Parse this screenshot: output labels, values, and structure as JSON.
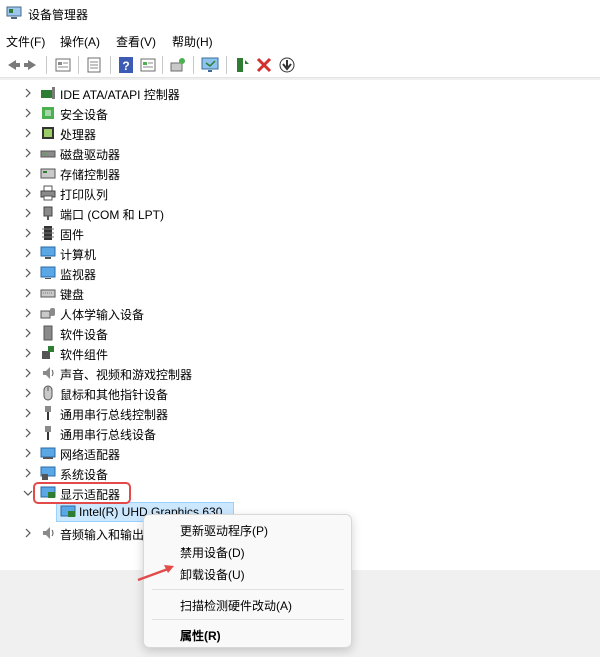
{
  "window": {
    "title": "设备管理器"
  },
  "menu": [
    "文件(F)",
    "操作(A)",
    "查看(V)",
    "帮助(H)"
  ],
  "toolbar": {
    "buttons": [
      "back-arrow-icon",
      "forward-arrow-icon",
      "properties-sheet-icon",
      "document-icon",
      "help-icon",
      "view-icon",
      "scan-hardware-icon",
      "monitor-icon",
      "update-driver-icon",
      "uninstall-x-icon",
      "download-icon"
    ]
  },
  "tree": {
    "categories": [
      "IDE ATA/ATAPI 控制器",
      "安全设备",
      "处理器",
      "磁盘驱动器",
      "存储控制器",
      "打印队列",
      "端口 (COM 和 LPT)",
      "固件",
      "计算机",
      "监视器",
      "键盘",
      "人体学输入设备",
      "软件设备",
      "软件组件",
      "声音、视频和游戏控制器",
      "鼠标和其他指针设备",
      "通用串行总线控制器",
      "通用串行总线设备",
      "网络适配器",
      "系统设备",
      "显示适配器"
    ],
    "expanded_child": "Intel(R) UHD Graphics 630",
    "after_child": "音频输入和输出"
  },
  "context_menu": {
    "items": [
      "更新驱动程序(P)",
      "禁用设备(D)",
      "卸载设备(U)",
      "扫描检测硬件改动(A)",
      "属性(R)"
    ]
  },
  "colors": {
    "highlight_border": "#e34b4b",
    "selection": "#cce8ff",
    "arrow": "#e34b4b"
  }
}
